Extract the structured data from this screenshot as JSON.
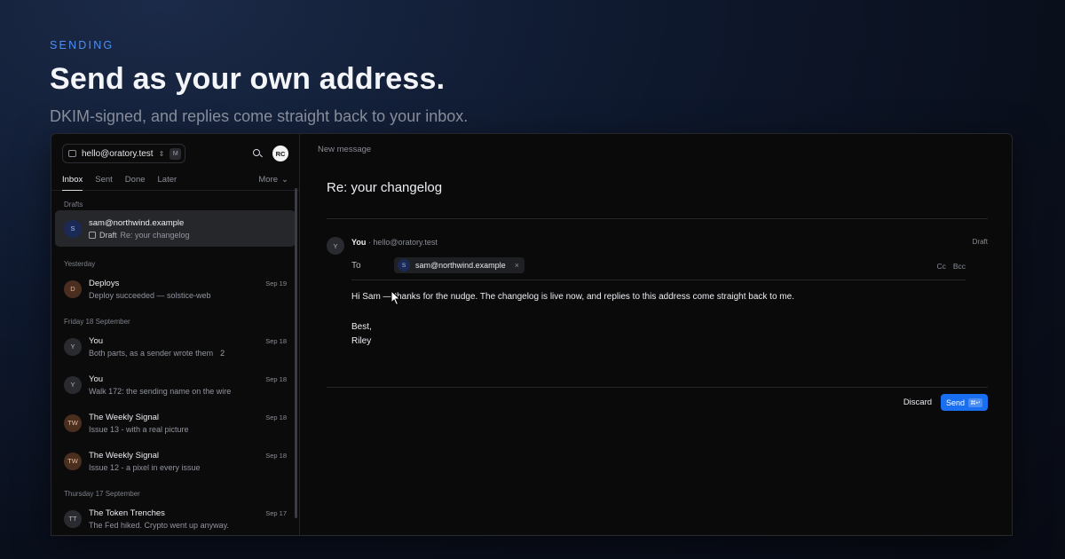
{
  "hero": {
    "eyebrow": "SENDING",
    "headline": "Send as your own address.",
    "subline": "DKIM-signed, and replies come straight back to your inbox."
  },
  "sidebar": {
    "account": "hello@oratory.test",
    "account_kbd": "M",
    "avatar_initials": "RC",
    "tabs": [
      "Inbox",
      "Sent",
      "Done",
      "Later"
    ],
    "more_label": "More",
    "sections": {
      "drafts": "Drafts",
      "yesterday": "Yesterday",
      "fri": "Friday 18 September",
      "thu": "Thursday 17 September"
    },
    "items": [
      {
        "initials": "S",
        "from": "sam@northwind.example",
        "tag": "Draft",
        "subject": "Re: your changelog",
        "date": ""
      },
      {
        "initials": "D",
        "from": "Deploys",
        "subject": "Deploy succeeded — solstice-web",
        "date": "Sep 19"
      },
      {
        "initials": "Y",
        "from": "You",
        "subject": "Both parts, as a sender wrote them",
        "count": "2",
        "date": "Sep 18"
      },
      {
        "initials": "Y",
        "from": "You",
        "subject": "Walk 172: the sending name on the wire",
        "date": "Sep 18"
      },
      {
        "initials": "TW",
        "from": "The Weekly Signal",
        "subject": "Issue 13 - with a real picture",
        "date": "Sep 18"
      },
      {
        "initials": "TW",
        "from": "The Weekly Signal",
        "subject": "Issue 12 - a pixel in every issue",
        "date": "Sep 18"
      },
      {
        "initials": "TT",
        "from": "The Token Trenches",
        "subject": "The Fed hiked. Crypto went up anyway.",
        "date": "Sep 17"
      }
    ]
  },
  "compose": {
    "header": "New message",
    "subject": "Re: your changelog",
    "from_initial": "Y",
    "from_name": "You",
    "from_addr": "· hello@oratory.test",
    "status": "Draft",
    "to_label": "To",
    "to_initial": "S",
    "to_addr": "sam@northwind.example",
    "to_remove": "×",
    "cc": "Cc",
    "bcc": "Bcc",
    "body_line1": "Hi Sam — thanks for the nudge. The changelog is live now, and replies to this address come straight back to me.",
    "body_signoff": "Best,",
    "body_name": "Riley",
    "discard_label": "Discard",
    "send_label": "Send",
    "send_kbd": "⌘↵"
  }
}
